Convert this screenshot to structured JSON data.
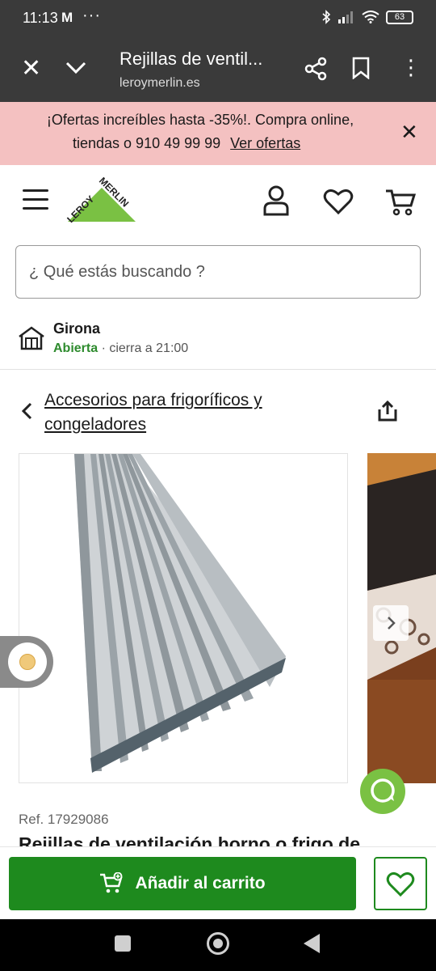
{
  "status_bar": {
    "time": "11:13",
    "notification_icon": "M",
    "more": "···",
    "battery": "63"
  },
  "browser": {
    "title": "Rejillas de ventil...",
    "url": "leroymerlin.es"
  },
  "promo": {
    "line1": "¡Ofertas increíbles hasta -35%!. Compra online,",
    "line2": "tiendas o 910 49 99 99",
    "link": "Ver ofertas",
    "bg_color": "#f4c1c1"
  },
  "logo": {
    "text1": "LEROY",
    "text2": "MERLIN",
    "brand_color": "#7ac143"
  },
  "search": {
    "placeholder": "¿ Qué estás buscando ?"
  },
  "store": {
    "name": "Girona",
    "status": "Abierta",
    "closing": "· cierra a 21:00"
  },
  "breadcrumb": {
    "label": "Accesorios para frigoríficos y congeladores"
  },
  "product": {
    "ref": "Ref. 17929086",
    "title": "Rejillas de ventilación horno o frigo de"
  },
  "actions": {
    "add_to_cart": "Añadir al carrito",
    "accent_color": "#1e8a1e"
  }
}
